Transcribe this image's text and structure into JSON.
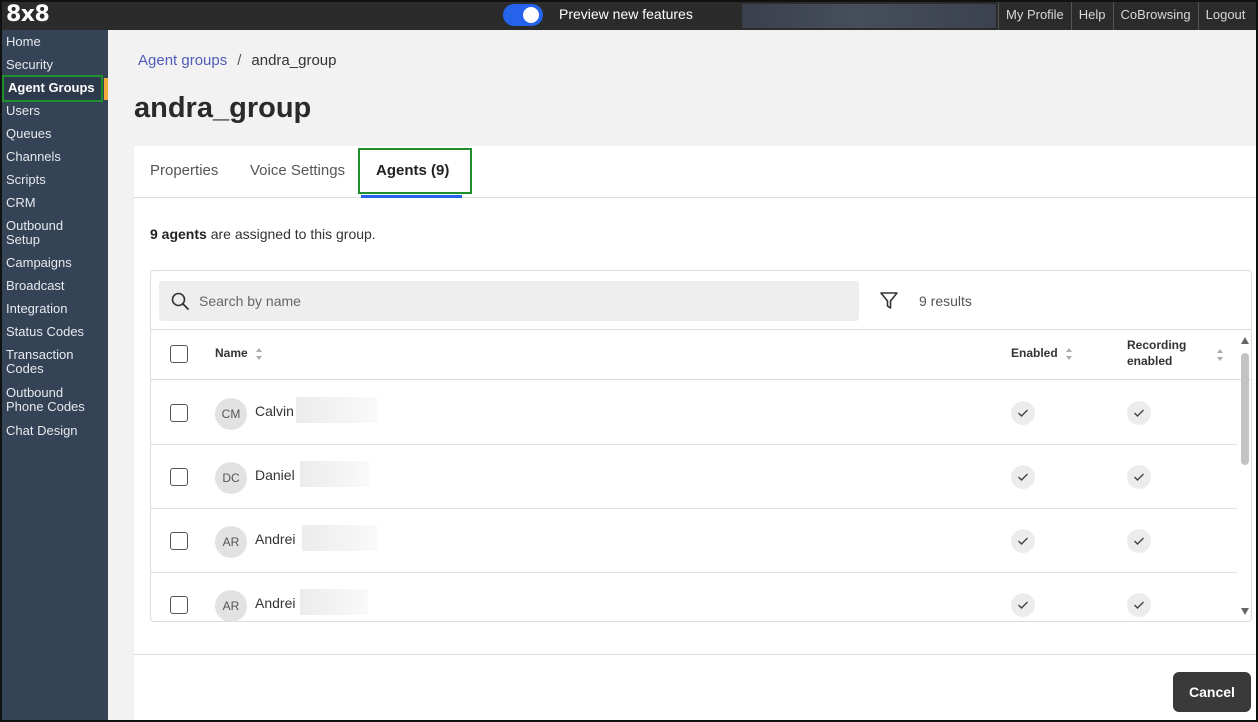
{
  "topbar": {
    "logo": "8x8",
    "preview_label": "Preview new features",
    "preview_enabled": true,
    "links": [
      "My Profile",
      "Help",
      "CoBrowsing",
      "Logout"
    ]
  },
  "sidebar": {
    "items": [
      {
        "label": "Home"
      },
      {
        "label": "Security"
      },
      {
        "label": "Agent Groups",
        "active": true
      },
      {
        "label": "Users"
      },
      {
        "label": "Queues"
      },
      {
        "label": "Channels"
      },
      {
        "label": "Scripts"
      },
      {
        "label": "CRM"
      },
      {
        "label": "Outbound Setup"
      },
      {
        "label": "Campaigns"
      },
      {
        "label": "Broadcast"
      },
      {
        "label": "Integration"
      },
      {
        "label": "Status Codes"
      },
      {
        "label": "Transaction Codes"
      },
      {
        "label": "Outbound Phone Codes"
      },
      {
        "label": "Chat Design"
      }
    ]
  },
  "breadcrumb": {
    "parent": "Agent groups",
    "separator": "/",
    "current": "andra_group"
  },
  "page_title": "andra_group",
  "tabs": [
    {
      "label": "Properties"
    },
    {
      "label": "Voice Settings"
    },
    {
      "label": "Agents (9)",
      "active": true
    }
  ],
  "summary": {
    "count_text": "9 agents",
    "rest_text": " are assigned to this group."
  },
  "search": {
    "placeholder": "Search by name"
  },
  "results_text": "9 results",
  "table": {
    "columns": {
      "name": "Name",
      "enabled": "Enabled",
      "recording_line1": "Recording",
      "recording_line2": "enabled"
    },
    "rows": [
      {
        "initials": "CM",
        "name": "Calvin",
        "enabled": true,
        "recording": true
      },
      {
        "initials": "DC",
        "name": "Daniel",
        "enabled": true,
        "recording": true
      },
      {
        "initials": "AR",
        "name": "Andrei",
        "enabled": true,
        "recording": true
      },
      {
        "initials": "AR",
        "name": "Andrei",
        "enabled": true,
        "recording": true
      }
    ]
  },
  "buttons": {
    "cancel": "Cancel"
  },
  "colors": {
    "sidebar_bg": "#354356",
    "accent_blue": "#2563eb",
    "highlight_green": "#1f8f2e",
    "active_marker": "#f3a93b"
  }
}
